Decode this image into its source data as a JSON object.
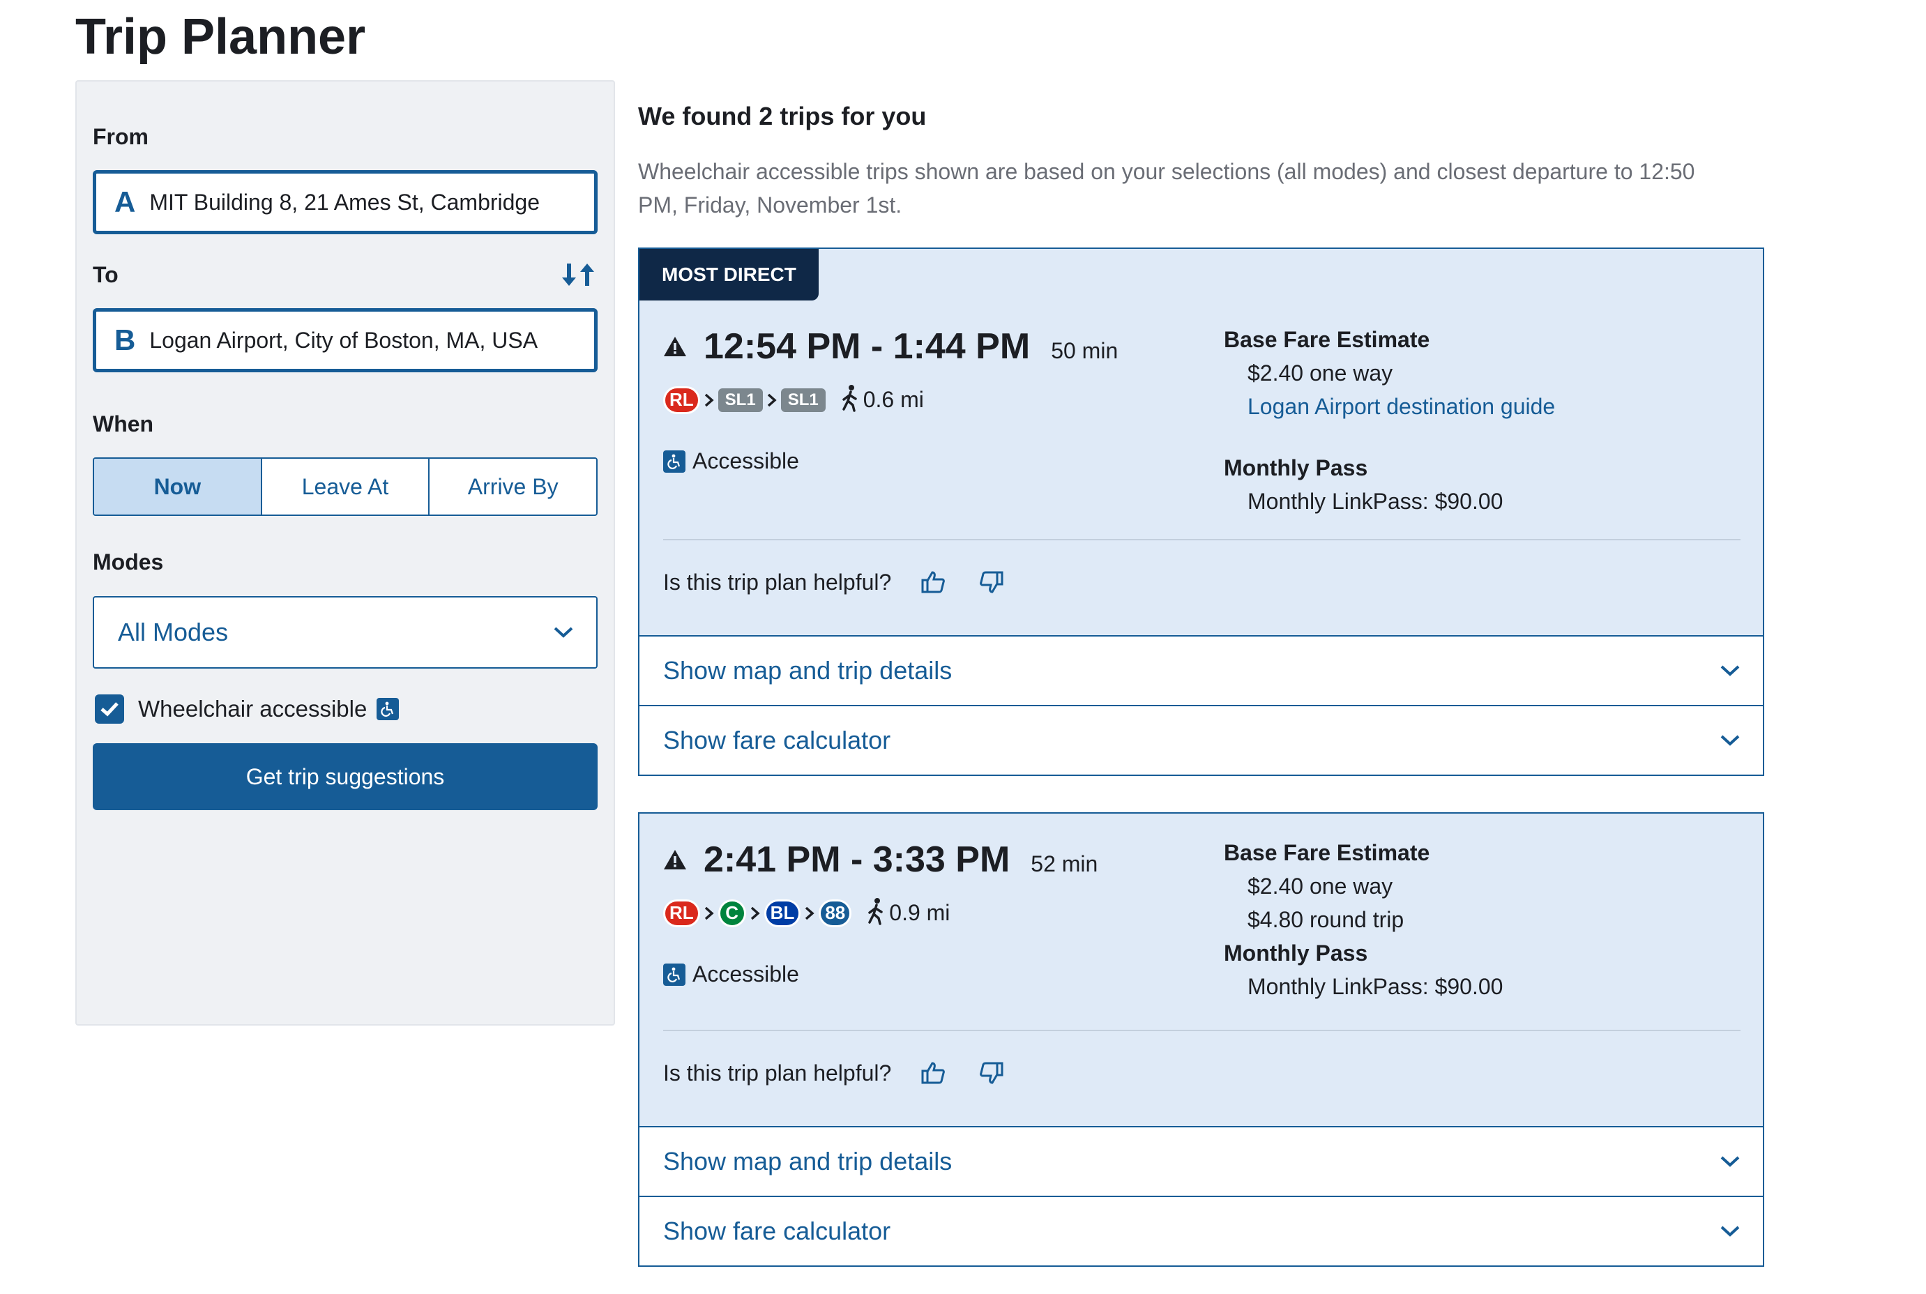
{
  "page": {
    "title": "Trip Planner"
  },
  "form": {
    "from_label": "From",
    "from_letter": "A",
    "from_value": "MIT Building 8, 21 Ames St, Cambridge",
    "to_label": "To",
    "to_letter": "B",
    "to_value": "Logan Airport, City of Boston, MA, USA",
    "swap_icon": "swap-arrows-icon",
    "when_label": "When",
    "when_options": [
      "Now",
      "Leave At",
      "Arrive By"
    ],
    "when_selected": "Now",
    "modes_label": "Modes",
    "modes_value": "All Modes",
    "wheelchair_label": "Wheelchair accessible",
    "wheelchair_checked": true,
    "submit_label": "Get trip suggestions"
  },
  "results": {
    "title": "We found 2 trips for you",
    "description": "Wheelchair accessible trips shown are based on your selections (all modes) and closest departure to 12:50 PM, Friday, November 1st.",
    "trips": [
      {
        "badge": "MOST DIRECT",
        "times": "12:54 PM - 1:44 PM",
        "duration": "50 min",
        "routes": [
          {
            "label": "RL",
            "shape": "circle",
            "color": "#da291c"
          },
          {
            "label": "SL1",
            "shape": "rect",
            "color": "#7c878e"
          },
          {
            "label": "SL1",
            "shape": "rect",
            "color": "#7c878e"
          }
        ],
        "walk": "0.6 mi",
        "accessible": "Accessible",
        "fare_heading": "Base Fare Estimate",
        "fare_lines": [
          "$2.40 one way"
        ],
        "fare_link": "Logan Airport destination guide",
        "pass_heading": "Monthly Pass",
        "pass_value": "Monthly LinkPass: $90.00",
        "helpful": "Is this trip plan helpful?",
        "map_toggle": "Show map and trip details",
        "fare_toggle": "Show fare calculator"
      },
      {
        "badge": "",
        "times": "2:41 PM - 3:33 PM",
        "duration": "52 min",
        "routes": [
          {
            "label": "RL",
            "shape": "circle",
            "color": "#da291c"
          },
          {
            "label": "C",
            "shape": "circle",
            "color": "#00843d"
          },
          {
            "label": "BL",
            "shape": "circle",
            "color": "#003da5"
          },
          {
            "label": "88",
            "shape": "circle",
            "color": "#165c96"
          }
        ],
        "walk": "0.9 mi",
        "accessible": "Accessible",
        "fare_heading": "Base Fare Estimate",
        "fare_lines": [
          "$2.40 one way",
          "$4.80 round trip"
        ],
        "fare_link": "",
        "pass_heading": "Monthly Pass",
        "pass_value": "Monthly LinkPass: $90.00",
        "helpful": "Is this trip plan helpful?",
        "map_toggle": "Show map and trip details",
        "fare_toggle": "Show fare calculator"
      }
    ]
  },
  "colors": {
    "primary": "#165c96",
    "card_bg": "#dfeaf7",
    "badge_bg": "#0f2847",
    "sidebar_bg": "#eff1f4"
  }
}
